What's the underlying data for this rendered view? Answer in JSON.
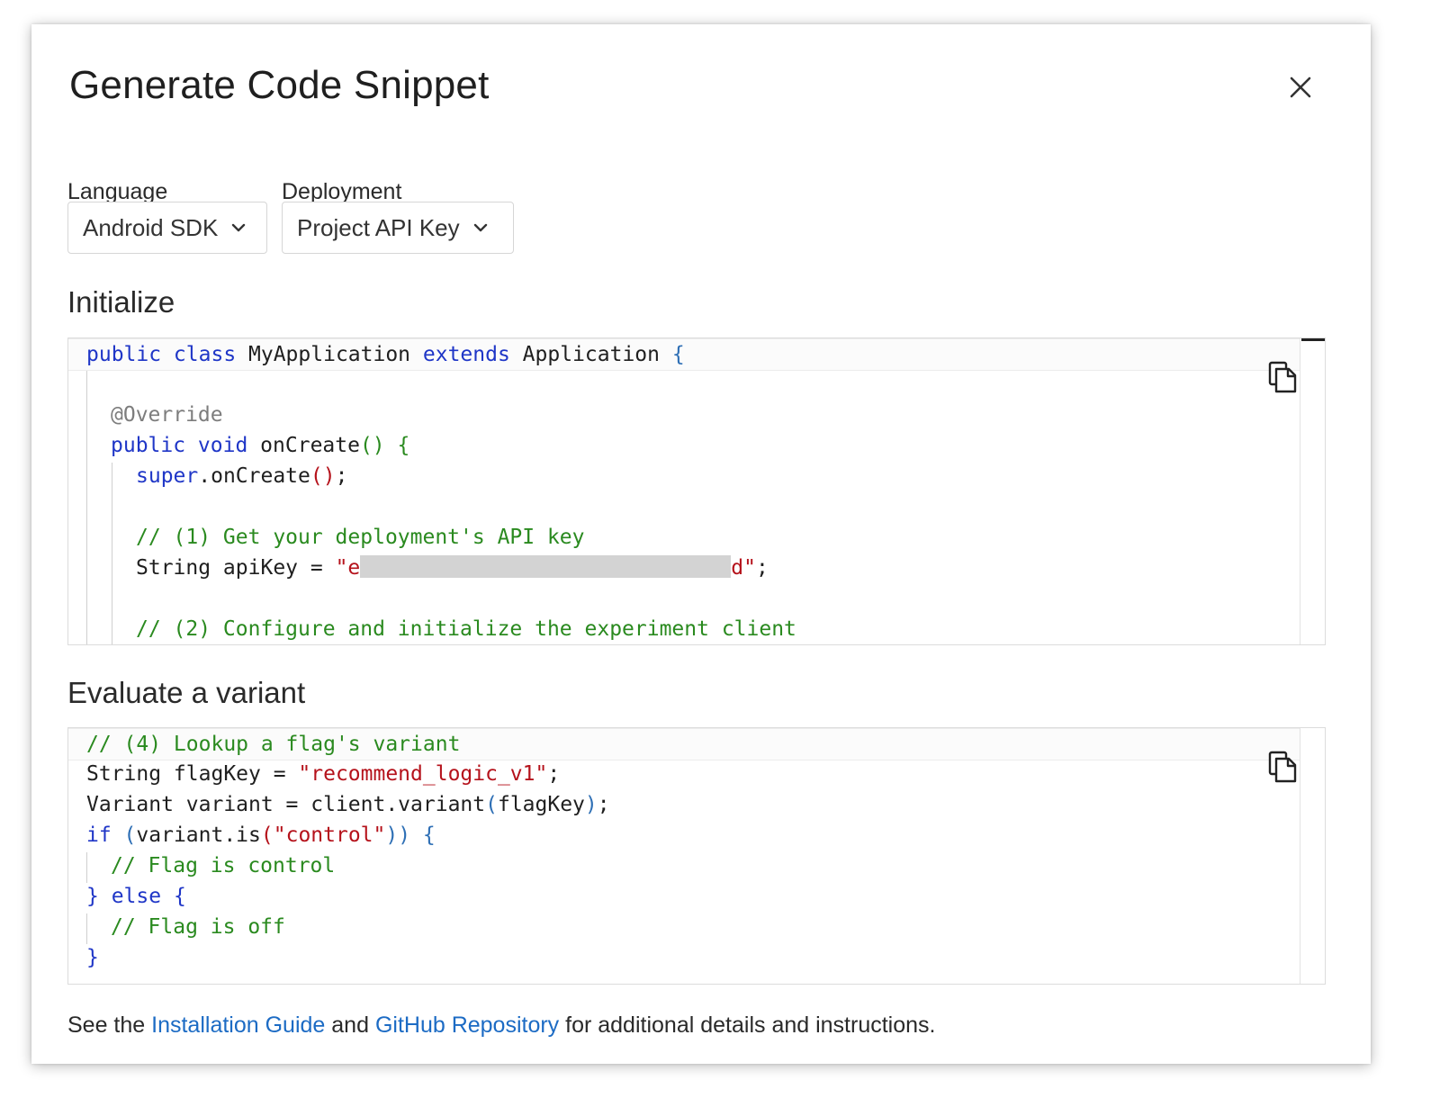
{
  "modal": {
    "title": "Generate Code Snippet",
    "close_icon": "close-icon"
  },
  "language": {
    "label": "Language",
    "selected": "Android SDK",
    "icon": "chevron-down-icon"
  },
  "deployment": {
    "label": "Deployment",
    "selected": "Project API Key",
    "icon": "chevron-down-icon"
  },
  "initialize": {
    "heading": "Initialize",
    "copy_icon": "copy-icon",
    "lines": {
      "l1": [
        "public class",
        " MyApplication ",
        "extends",
        " Application ",
        "{"
      ],
      "l3": "@Override",
      "l4": [
        "public void",
        " onCreate",
        "()",
        " {"
      ],
      "l5": [
        "super",
        ".onCreate",
        "()",
        ";"
      ],
      "l7": "// (1) Get your deployment's API key",
      "l8": [
        "String apiKey = ",
        "\"e",
        "d\"",
        ";"
      ],
      "l10": "// (2) Configure and initialize the experiment client"
    }
  },
  "evaluate": {
    "heading": "Evaluate a variant",
    "copy_icon": "copy-icon",
    "lines": {
      "l1": "// (4) Lookup a flag's variant",
      "l2": [
        "String flagKey = ",
        "\"recommend_logic_v1\"",
        ";"
      ],
      "l3": [
        "Variant variant = client.variant",
        "(",
        "flagKey",
        ")",
        ";"
      ],
      "l4": [
        "if",
        " (",
        "variant.is",
        "(",
        "\"control\"",
        "))",
        " {"
      ],
      "l5": "// Flag is control",
      "l6": [
        "}",
        " else",
        " {"
      ],
      "l7": "// Flag is off",
      "l8": "}"
    }
  },
  "footer": {
    "prefix": "See the ",
    "link1": "Installation Guide",
    "middle": " and ",
    "link2": "GitHub Repository",
    "suffix": " for additional details and instructions."
  }
}
